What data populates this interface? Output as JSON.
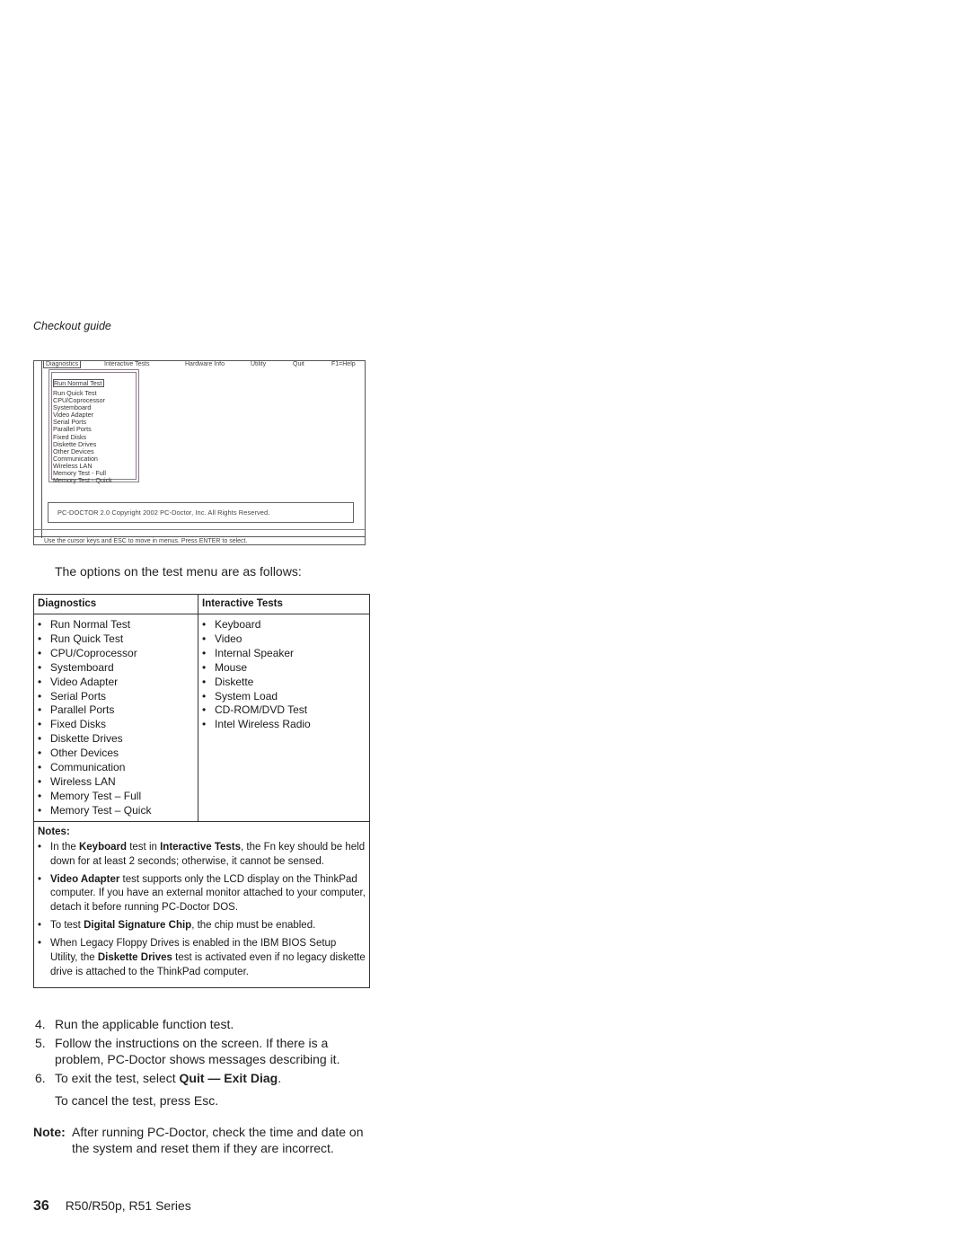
{
  "section_title": "Checkout guide",
  "screen": {
    "menu": [
      "Diagnostics",
      "Interactive Tests",
      "Hardware Info",
      "Utility",
      "Quit",
      "F1=Help"
    ],
    "active_menu": "Diagnostics",
    "dropdown_items": [
      "Run Normal Test",
      "Run Quick Test",
      "CPU/Coprocessor",
      "Systemboard",
      "Video Adapter",
      "Serial Ports",
      "Parallel Ports",
      "Fixed Disks",
      "Diskette Drives",
      "Other Devices",
      "Communication",
      "Wireless LAN",
      "Memory Test - Full",
      "Memory Test - Quick"
    ],
    "selected_item": "Run Normal Test",
    "copyright": "PC-DOCTOR 2.0   Copyright 2002  PC-Doctor,  Inc.   All Rights Reserved.",
    "status": "Use the cursor keys and ESC to move in menus.  Press ENTER to select."
  },
  "intro": "The options on the test menu are as follows:",
  "table": {
    "headers": [
      "Diagnostics",
      "Interactive Tests"
    ],
    "diagnostics": [
      "Run Normal Test",
      "Run Quick Test",
      "CPU/Coprocessor",
      "Systemboard",
      "Video Adapter",
      "Serial Ports",
      "Parallel Ports",
      "Fixed Disks",
      "Diskette Drives",
      "Other Devices",
      "Communication",
      "Wireless LAN",
      "Memory Test – Full",
      "Memory Test – Quick"
    ],
    "interactive": [
      "Keyboard",
      "Video",
      "Internal Speaker",
      "Mouse",
      "Diskette",
      "System Load",
      "CD-ROM/DVD Test",
      "Intel Wireless Radio"
    ],
    "bullet": "•",
    "notes_title": "Notes:",
    "notes": [
      {
        "parts": [
          [
            "In the ",
            false
          ],
          [
            "Keyboard",
            true
          ],
          [
            " test in ",
            false
          ],
          [
            "Interactive Tests",
            true
          ],
          [
            ", the Fn key should be held down for at least 2 seconds; otherwise, it cannot be sensed.",
            false
          ]
        ]
      },
      {
        "parts": [
          [
            "Video Adapter",
            true
          ],
          [
            " test supports only the LCD display on the ThinkPad computer. If you have an external monitor attached to your computer, detach it before running PC-Doctor DOS.",
            false
          ]
        ]
      },
      {
        "parts": [
          [
            "To test ",
            false
          ],
          [
            "Digital Signature Chip",
            true
          ],
          [
            ", the chip must be enabled.",
            false
          ]
        ]
      },
      {
        "parts": [
          [
            "When Legacy Floppy Drives is enabled in the IBM BIOS Setup Utility, the ",
            false
          ],
          [
            "Diskette Drives",
            true
          ],
          [
            " test is activated even if no legacy diskette drive is attached to the ThinkPad computer.",
            false
          ]
        ]
      }
    ]
  },
  "steps": [
    {
      "num": "4.",
      "text": "Run the applicable function test."
    },
    {
      "num": "5.",
      "text": "Follow the instructions on the screen. If there is a problem, PC-Doctor shows messages describing it."
    },
    {
      "num": "6.",
      "text_before": "To exit the test, select ",
      "bold": "Quit — Exit Diag",
      "text_after": ".",
      "extra": "To cancel the test, press Esc."
    }
  ],
  "note": {
    "label": "Note:",
    "text": "After running PC-Doctor, check the time and date on the system and reset them if they are incorrect."
  },
  "footer": {
    "page_number": "36",
    "title": "R50/R50p, R51 Series"
  }
}
